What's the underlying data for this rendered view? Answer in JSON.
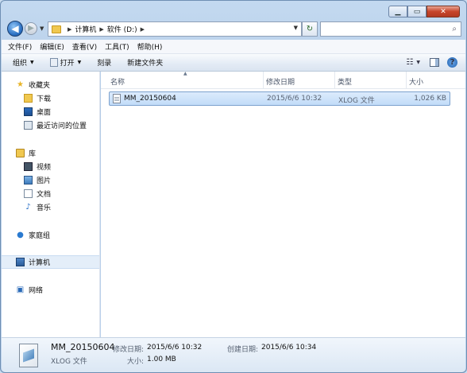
{
  "window": {
    "caption_buttons": {
      "minimize": "▁",
      "maximize": "▭",
      "close": "✕"
    }
  },
  "address": {
    "back_glyph": "◀",
    "forward_glyph": "▶",
    "crumbs": [
      "计算机",
      "软件 (D:)"
    ],
    "separator": "▶",
    "refresh_glyph": "↻",
    "search_placeholder": "",
    "search_glyph": "⌕"
  },
  "menubar": {
    "items": [
      "文件(F)",
      "编辑(E)",
      "查看(V)",
      "工具(T)",
      "帮助(H)"
    ]
  },
  "toolbar": {
    "organize": "组织",
    "open": "打开",
    "burn": "刻录",
    "new_folder": "新建文件夹",
    "view_glyph": "☷",
    "help_glyph": "?"
  },
  "navpane": {
    "favorites": "收藏夹",
    "downloads": "下载",
    "desktop": "桌面",
    "recent": "最近访问的位置",
    "libraries": "库",
    "videos": "视频",
    "pictures": "图片",
    "documents": "文档",
    "music": "音乐",
    "homegroup": "家庭组",
    "computer": "计算机",
    "network": "网络"
  },
  "columns": {
    "name": "名称",
    "modified": "修改日期",
    "type": "类型",
    "size": "大小"
  },
  "files": [
    {
      "name": "MM_20150604",
      "modified": "2015/6/6 10:32",
      "type": "XLOG 文件",
      "size": "1,026 KB"
    }
  ],
  "details": {
    "name": "MM_20150604",
    "type": "XLOG 文件",
    "modified_label": "修改日期:",
    "modified_value": "2015/6/6 10:32",
    "created_label": "创建日期:",
    "created_value": "2015/6/6 10:34",
    "size_label": "大小:",
    "size_value": "1.00 MB"
  }
}
